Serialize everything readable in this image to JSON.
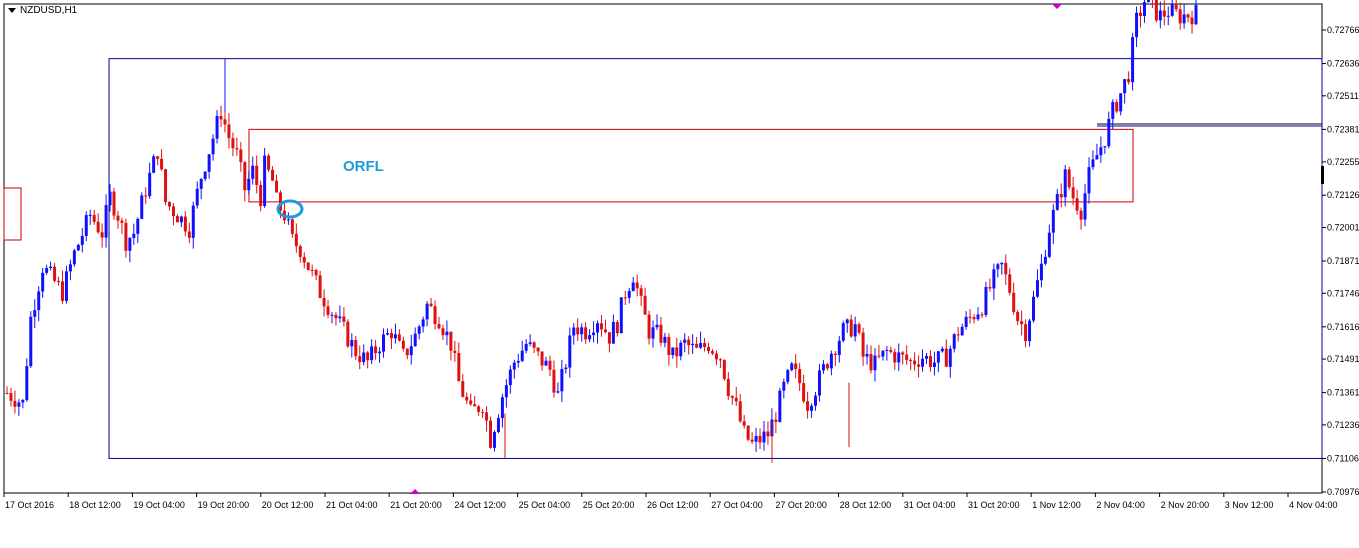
{
  "window": {
    "symbol_label": "NZDUSD,H1"
  },
  "annotation": {
    "text": "ORFL",
    "color": "#1e9bd7"
  },
  "colors": {
    "bull": "#1010ff",
    "bear": "#dd1111",
    "zone_outer": "#000099",
    "zone_inner": "#cc0000",
    "marker": "#cc00cc",
    "circle": "#1e9bd7"
  },
  "chart_data": {
    "type": "candlestick",
    "title": "NZDUSD,H1",
    "ylim": [
      0.70976,
      0.7283
    ],
    "y_ticks": [
      "0.72766",
      "0.72636",
      "0.72511",
      "0.72381",
      "0.72255",
      "0.72126",
      "0.72001",
      "0.71871",
      "0.71746",
      "0.71616",
      "0.71491",
      "0.71361",
      "0.71236",
      "0.71106",
      "0.70976"
    ],
    "x_ticks": [
      "17 Oct 2016",
      "18 Oct 12:00",
      "19 Oct 04:00",
      "19 Oct 20:00",
      "20 Oct 12:00",
      "21 Oct 04:00",
      "21 Oct 20:00",
      "24 Oct 12:00",
      "25 Oct 04:00",
      "25 Oct 20:00",
      "26 Oct 12:00",
      "27 Oct 04:00",
      "27 Oct 20:00",
      "28 Oct 12:00",
      "31 Oct 04:00",
      "31 Oct 20:00",
      "1 Nov 12:00",
      "2 Nov 04:00",
      "2 Nov 20:00",
      "3 Nov 12:00",
      "4 Nov 04:00"
    ],
    "close_path": [
      [
        0,
        0.7136
      ],
      [
        4,
        0.7132
      ],
      [
        6,
        0.7165
      ],
      [
        9,
        0.7185
      ],
      [
        14,
        0.7175
      ],
      [
        17,
        0.719
      ],
      [
        21,
        0.7205
      ],
      [
        24,
        0.7198
      ],
      [
        26,
        0.7212
      ],
      [
        28,
        0.7205
      ],
      [
        30,
        0.7195
      ],
      [
        32,
        0.7198
      ],
      [
        35,
        0.7215
      ],
      [
        38,
        0.723
      ],
      [
        40,
        0.721
      ],
      [
        43,
        0.7205
      ],
      [
        46,
        0.72
      ],
      [
        49,
        0.722
      ],
      [
        52,
        0.7235
      ],
      [
        54,
        0.7245
      ],
      [
        56,
        0.7235
      ],
      [
        58,
        0.7228
      ],
      [
        60,
        0.7215
      ],
      [
        62,
        0.7222
      ],
      [
        64,
        0.7212
      ],
      [
        65,
        0.7224
      ],
      [
        67,
        0.7218
      ],
      [
        68,
        0.721
      ],
      [
        70,
        0.7205
      ],
      [
        72,
        0.7195
      ],
      [
        74,
        0.7192
      ],
      [
        76,
        0.7185
      ],
      [
        79,
        0.7175
      ],
      [
        81,
        0.717
      ],
      [
        85,
        0.716
      ],
      [
        88,
        0.7152
      ],
      [
        91,
        0.7148
      ],
      [
        94,
        0.7155
      ],
      [
        97,
        0.716
      ],
      [
        100,
        0.715
      ],
      [
        103,
        0.7158
      ],
      [
        106,
        0.717
      ],
      [
        109,
        0.7165
      ],
      [
        112,
        0.7155
      ],
      [
        114,
        0.714
      ],
      [
        117,
        0.7128
      ],
      [
        120,
        0.7132
      ],
      [
        122,
        0.7118
      ],
      [
        125,
        0.7135
      ],
      [
        128,
        0.7148
      ],
      [
        131,
        0.7155
      ],
      [
        134,
        0.715
      ],
      [
        137,
        0.7145
      ],
      [
        139,
        0.7135
      ],
      [
        141,
        0.7148
      ],
      [
        143,
        0.7162
      ],
      [
        146,
        0.716
      ],
      [
        149,
        0.7165
      ],
      [
        152,
        0.7158
      ],
      [
        154,
        0.7163
      ],
      [
        156,
        0.7175
      ],
      [
        158,
        0.7182
      ],
      [
        160,
        0.717
      ],
      [
        162,
        0.716
      ],
      [
        165,
        0.7158
      ],
      [
        168,
        0.715
      ],
      [
        171,
        0.7155
      ],
      [
        174,
        0.7152
      ],
      [
        177,
        0.7155
      ],
      [
        180,
        0.715
      ],
      [
        182,
        0.7138
      ],
      [
        184,
        0.713
      ],
      [
        186,
        0.712
      ],
      [
        188,
        0.7116
      ],
      [
        190,
        0.7118
      ],
      [
        192,
        0.712
      ],
      [
        194,
        0.7128
      ],
      [
        196,
        0.7138
      ],
      [
        198,
        0.7145
      ],
      [
        200,
        0.714
      ],
      [
        202,
        0.7132
      ],
      [
        204,
        0.7138
      ],
      [
        206,
        0.7145
      ],
      [
        208,
        0.7152
      ],
      [
        211,
        0.716
      ],
      [
        214,
        0.7162
      ],
      [
        216,
        0.715
      ],
      [
        219,
        0.7147
      ],
      [
        222,
        0.7152
      ],
      [
        225,
        0.715
      ],
      [
        228,
        0.7148
      ],
      [
        231,
        0.715
      ],
      [
        234,
        0.7148
      ],
      [
        237,
        0.715
      ],
      [
        240,
        0.716
      ],
      [
        243,
        0.7165
      ],
      [
        246,
        0.717
      ],
      [
        249,
        0.718
      ],
      [
        251,
        0.7185
      ],
      [
        253,
        0.7176
      ],
      [
        255,
        0.7165
      ],
      [
        257,
        0.716
      ],
      [
        259,
        0.7172
      ],
      [
        261,
        0.7185
      ],
      [
        263,
        0.72
      ],
      [
        265,
        0.721
      ],
      [
        267,
        0.722
      ],
      [
        269,
        0.7212
      ],
      [
        271,
        0.7207
      ],
      [
        273,
        0.722
      ],
      [
        275,
        0.7228
      ],
      [
        277,
        0.7235
      ],
      [
        279,
        0.7245
      ],
      [
        281,
        0.7252
      ],
      [
        283,
        0.726
      ],
      [
        285,
        0.728
      ],
      [
        287,
        0.7288
      ],
      [
        291,
        0.7282
      ],
      [
        293,
        0.7284
      ],
      [
        296,
        0.7282
      ],
      [
        300,
        0.7283
      ]
    ],
    "annotations": [
      "ORFL"
    ]
  }
}
